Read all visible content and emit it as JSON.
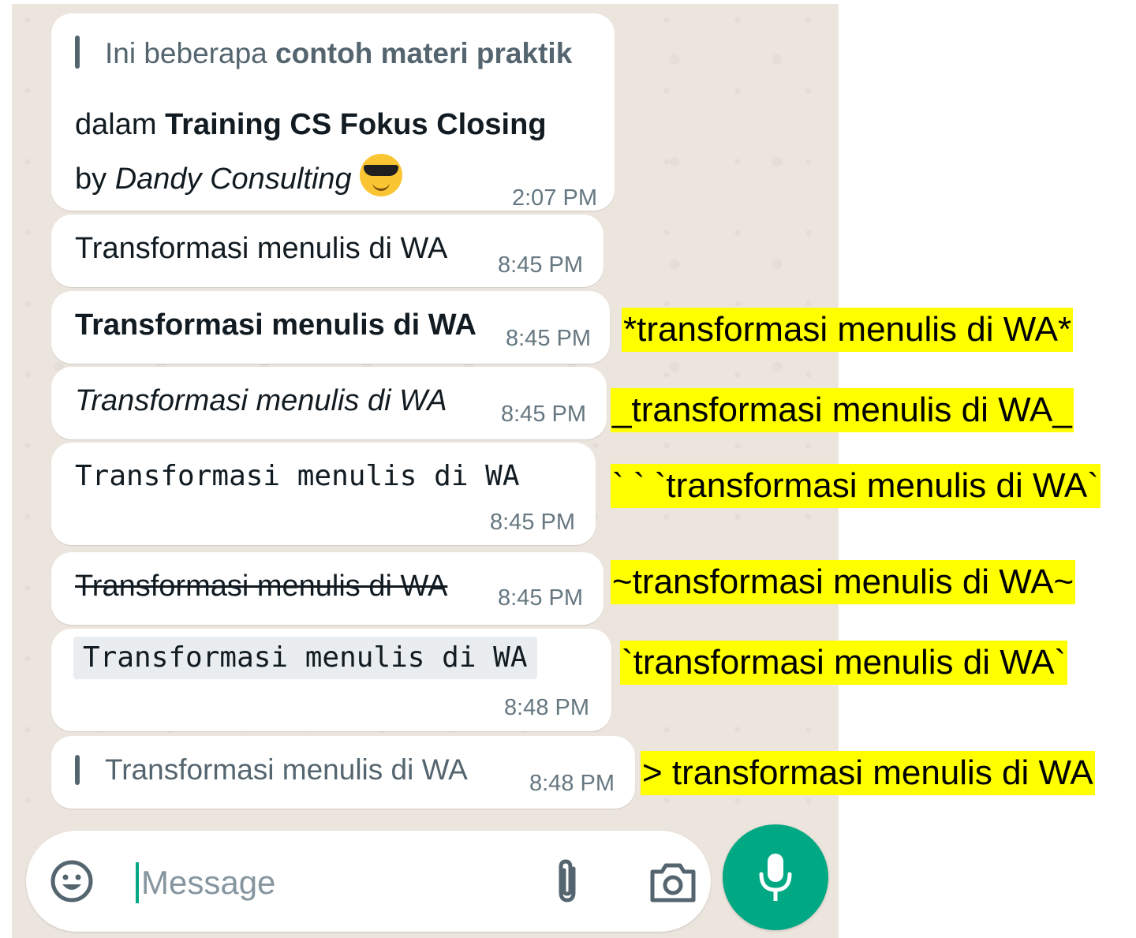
{
  "messages": [
    {
      "quote_plain": "Ini beberapa ",
      "quote_bold": "contoh materi praktik",
      "line2_plain": "dalam ",
      "line2_bold": "Training CS Fokus Closing",
      "line3_plain": "by ",
      "line3_italic": "Dandy Consulting",
      "emoji": "smiling-face-with-sunglasses",
      "time": "2:07 PM"
    },
    {
      "text": "Transformasi menulis di WA",
      "style": "normal",
      "time": "8:45 PM"
    },
    {
      "text": "Transformasi menulis di WA",
      "style": "bold",
      "time": "8:45 PM"
    },
    {
      "text": "Transformasi menulis di WA",
      "style": "italic",
      "time": "8:45 PM"
    },
    {
      "text": "Transformasi menulis di WA",
      "style": "monospace",
      "time": "8:45 PM"
    },
    {
      "text": "Transformasi menulis di WA",
      "style": "strikethrough",
      "time": "8:45 PM"
    },
    {
      "text": "Transformasi menulis di WA",
      "style": "inline-code",
      "time": "8:48 PM"
    },
    {
      "text": "Transformasi menulis di WA",
      "style": "quote",
      "time": "8:48 PM"
    }
  ],
  "composer": {
    "placeholder": "Message",
    "icons": [
      "emoji-icon",
      "paperclip-icon",
      "camera-icon",
      "microphone-icon"
    ]
  },
  "annotations": [
    "*transformasi menulis di WA*",
    "_transformasi menulis di WA_",
    "` ` `transformasi menulis di WA`",
    "~transformasi menulis di WA~",
    "`transformasi menulis di WA`",
    "> transformasi menulis di WA"
  ],
  "colors": {
    "chat_background": "#ece5dd",
    "bubble": "#ffffff",
    "accent": "#00a884",
    "highlight": "#ffff00",
    "timestamp": "#667781"
  }
}
